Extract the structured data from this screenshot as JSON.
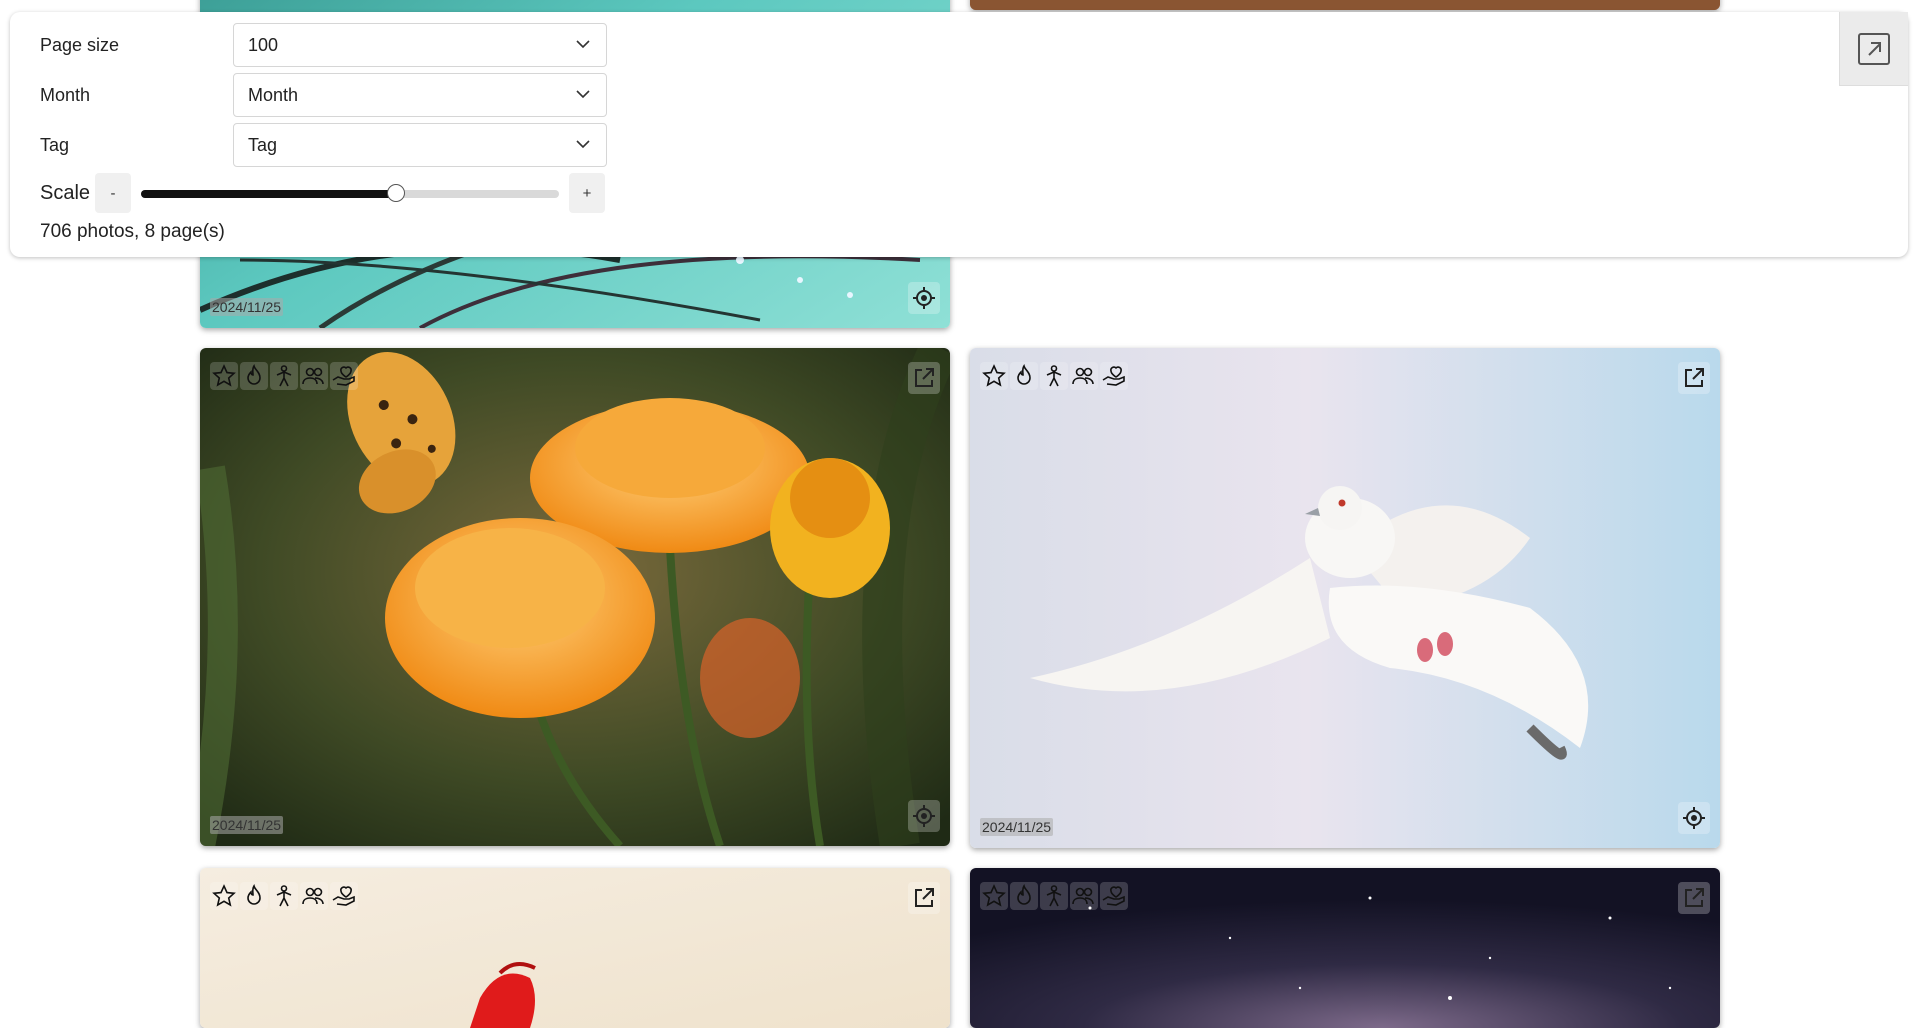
{
  "filters": {
    "page_size": {
      "label": "Page size",
      "value": "100"
    },
    "month": {
      "label": "Month",
      "value": "Month"
    },
    "tag": {
      "label": "Tag",
      "value": "Tag"
    },
    "scale": {
      "label": "Scale",
      "minus": "-",
      "plus": "+",
      "level": 0.61
    }
  },
  "summary": "706 photos, 8 page(s)",
  "icons": {
    "rating": [
      "star-icon",
      "flame-icon",
      "person-icon",
      "people-icon",
      "hand-heart-icon"
    ],
    "open": "open-external-icon",
    "locate": "locate-icon",
    "expand": "expand-icon"
  },
  "photos": [
    {
      "subject": "dandelion-dew",
      "date": "2024/11/25"
    },
    {
      "subject": "wood",
      "date": ""
    },
    {
      "subject": "butterfly-flowers",
      "date": "2024/11/25"
    },
    {
      "subject": "white-dove",
      "date": "2024/11/25"
    },
    {
      "subject": "red-poppy",
      "date": ""
    },
    {
      "subject": "night-sky",
      "date": ""
    }
  ],
  "colors": {
    "accent": "#111111",
    "panel_bg": "#ffffff"
  }
}
